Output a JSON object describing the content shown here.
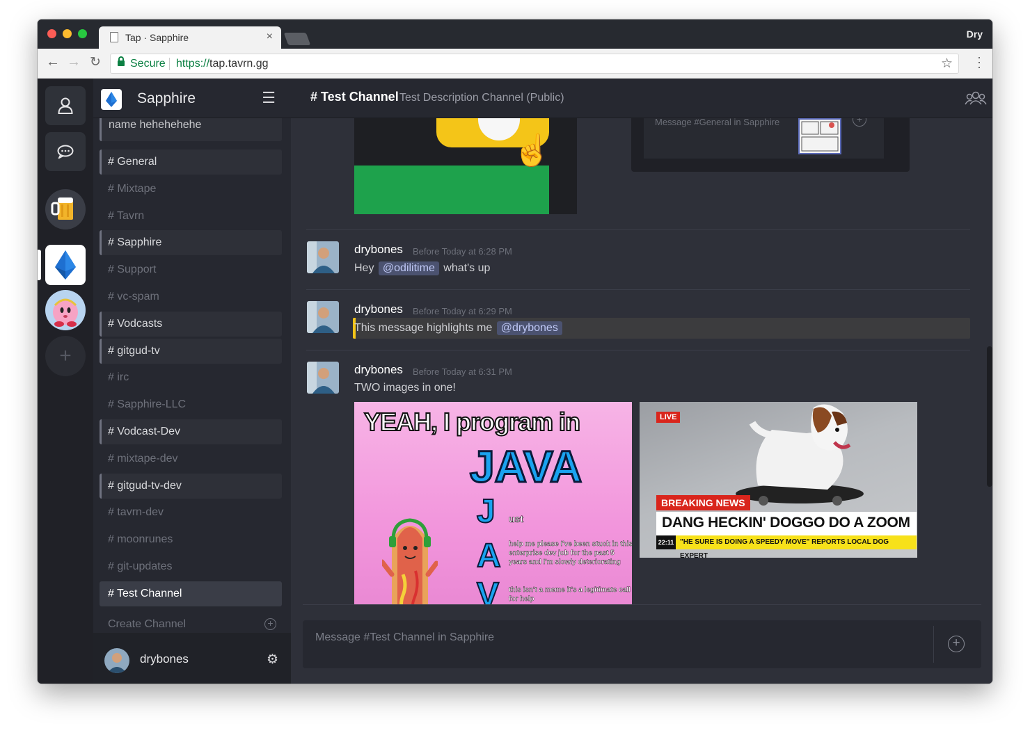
{
  "browser": {
    "tab_title": "Tap · Sapphire",
    "tab_close": "×",
    "profile_name": "Dry",
    "secure_label": "Secure",
    "url_scheme": "https://",
    "url_rest": "tap.tavrn.gg"
  },
  "app": {
    "server_name": "Sapphire",
    "channels": [
      {
        "label": "# General",
        "state": "unread"
      },
      {
        "label": "# Mixtape",
        "state": "read"
      },
      {
        "label": "# Tavrn",
        "state": "read"
      },
      {
        "label": "# Sapphire",
        "state": "unread"
      },
      {
        "label": "# Support",
        "state": "read"
      },
      {
        "label": "# vc-spam",
        "state": "read"
      },
      {
        "label": "# Vodcasts",
        "state": "unread"
      },
      {
        "label": "# gitgud-tv",
        "state": "unread"
      },
      {
        "label": "# irc",
        "state": "read"
      },
      {
        "label": "# Sapphire-LLC",
        "state": "read"
      },
      {
        "label": "# Vodcast-Dev",
        "state": "unread"
      },
      {
        "label": "# mixtape-dev",
        "state": "read"
      },
      {
        "label": "# gitgud-tv-dev",
        "state": "unread"
      },
      {
        "label": "# tavrn-dev",
        "state": "read"
      },
      {
        "label": "# moonrunes",
        "state": "read"
      },
      {
        "label": "# git-updates",
        "state": "read"
      },
      {
        "label": "# Test Channel",
        "state": "active"
      }
    ],
    "long_channel_label": "# This is a really long channel name hehehehehe",
    "create_channel_label": "Create Channel",
    "current_user": "drybones",
    "header": {
      "title": "# Test Channel",
      "description": "Test Description Channel (Public)"
    },
    "previous_embed_placeholder": "Message #General in Sapphire",
    "messages": [
      {
        "author": "drybones",
        "time": "Before Today at 6:28 PM",
        "text_before": "Hey",
        "mention": "@odilitime",
        "text_after": "what's up"
      },
      {
        "author": "drybones",
        "time": "Before Today at 6:29 PM",
        "text_before": "This message highlights me",
        "mention": "@drybones"
      },
      {
        "author": "drybones",
        "time": "Before Today at 6:31 PM",
        "text": "TWO images in one!"
      }
    ],
    "image_java": {
      "line1": "YEAH, I program in",
      "big": "JAVA",
      "letter_j": "J",
      "letter_a": "A",
      "letter_v": "V",
      "ust": "ust",
      "small1": "help me please I've been stuck in this enterprise dev job for the past 5 years and I'm slowly deteriorating",
      "small2": "this isn't a meme it's a legitimate call for help"
    },
    "image_news": {
      "live": "LIVE",
      "breaking": "BREAKING NEWS",
      "headline": "DANG HECKIN' DOGGO DO A ZOOM",
      "ticker_time": "22:11",
      "ticker": "\"HE SURE IS DOING A SPEEDY MOVE\" REPORTS LOCAL DOG EXPERT"
    },
    "composer_placeholder": "Message #Test Channel in Sapphire"
  },
  "icons": {
    "profile": "user-icon",
    "chat": "chat-bubble-icon",
    "add_server": "plus-icon",
    "hamburger": "menu-icon",
    "settings": "gear-icon",
    "members": "users-icon"
  },
  "colors": {
    "mention_bg": "#4b5270",
    "highlight_bar": "#f4c518",
    "server_bg": "#202127",
    "sidebar_bg": "#262830",
    "main_bg": "#2e3039"
  }
}
